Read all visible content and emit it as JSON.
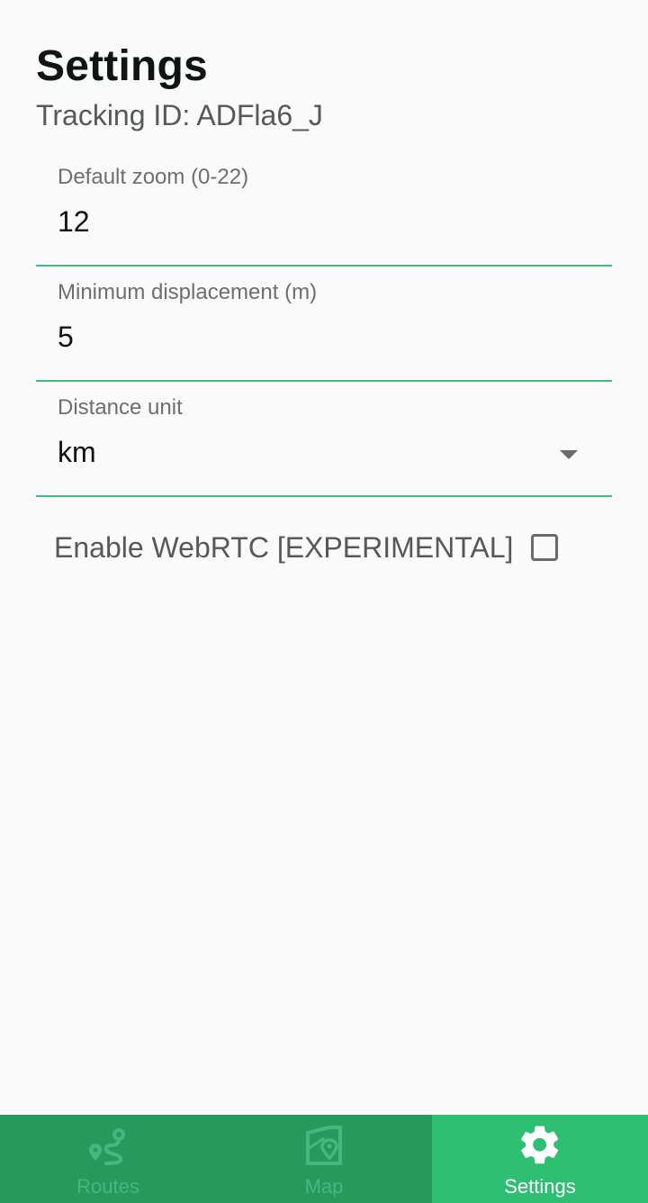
{
  "header": {
    "title": "Settings",
    "tracking_id": "Tracking ID: ADFla6_J"
  },
  "fields": {
    "default_zoom": {
      "label": "Default zoom (0-22)",
      "value": "12"
    },
    "min_displacement": {
      "label": "Minimum displacement (m)",
      "value": "5"
    },
    "distance_unit": {
      "label": "Distance unit",
      "value": "km"
    }
  },
  "webrtc": {
    "label": "Enable WebRTC [EXPERIMENTAL]",
    "checked": false
  },
  "bottom_nav": {
    "items": [
      {
        "label": "Routes",
        "icon": "route-icon",
        "active": false
      },
      {
        "label": "Map",
        "icon": "map-icon",
        "active": false
      },
      {
        "label": "Settings",
        "icon": "gear-icon",
        "active": true
      }
    ]
  },
  "colors": {
    "accent": "#43b97f",
    "nav_background": "#26995b",
    "nav_active_background": "#2fbf72",
    "page_background": "#fafafa"
  }
}
